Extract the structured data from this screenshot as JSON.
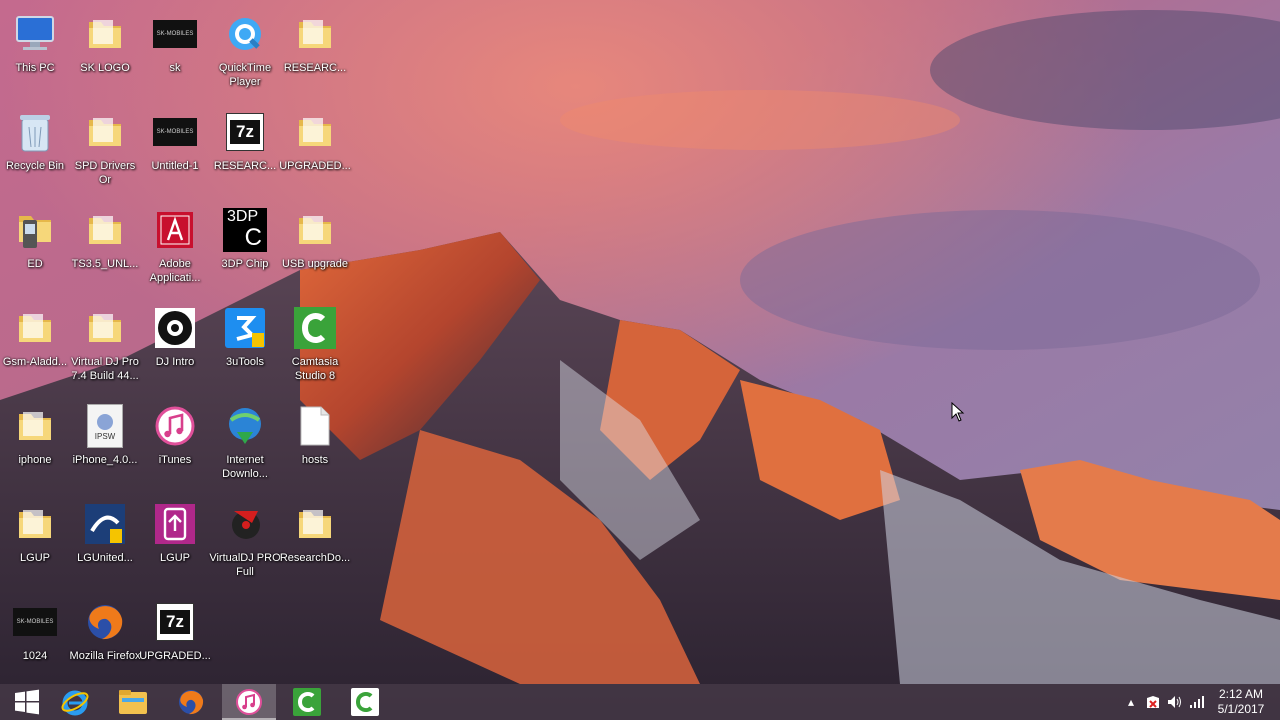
{
  "desktop": {
    "icons": [
      {
        "label": "This PC",
        "icon": "computer-icon"
      },
      {
        "label": "SK LOGO",
        "icon": "folder-icon"
      },
      {
        "label": "sk",
        "icon": "image-icon"
      },
      {
        "label": "QuickTime Player",
        "icon": "quicktime-icon"
      },
      {
        "label": "RESEARC...",
        "icon": "folder-icon"
      },
      {
        "label": "Recycle Bin",
        "icon": "recycle-bin-icon"
      },
      {
        "label": "SPD Drivers Or",
        "icon": "folder-icon"
      },
      {
        "label": "Untitled-1",
        "icon": "image-icon"
      },
      {
        "label": "RESEARC...",
        "icon": "7zip-icon"
      },
      {
        "label": "UPGRADED...",
        "icon": "folder-icon"
      },
      {
        "label": "ED",
        "icon": "phone-folder-icon"
      },
      {
        "label": "TS3.5_UNL...",
        "icon": "folder-icon"
      },
      {
        "label": "Adobe Applicati...",
        "icon": "adobe-icon"
      },
      {
        "label": "3DP Chip",
        "icon": "3dp-chip-icon"
      },
      {
        "label": "USB upgrade",
        "icon": "folder-icon"
      },
      {
        "label": "Gsm-Aladd...",
        "icon": "folder-icon"
      },
      {
        "label": "Virtual DJ Pro 7.4 Build 44...",
        "icon": "folder-icon"
      },
      {
        "label": "DJ Intro",
        "icon": "dj-intro-icon"
      },
      {
        "label": "3uTools",
        "icon": "3utools-icon"
      },
      {
        "label": "Camtasia Studio 8",
        "icon": "camtasia-icon"
      },
      {
        "label": "iphone",
        "icon": "folder-icon"
      },
      {
        "label": "iPhone_4.0...",
        "icon": "ipsw-icon"
      },
      {
        "label": "iTunes",
        "icon": "itunes-icon"
      },
      {
        "label": "Internet Downlo...",
        "icon": "idm-icon"
      },
      {
        "label": "hosts",
        "icon": "file-icon"
      },
      {
        "label": "LGUP",
        "icon": "folder-icon"
      },
      {
        "label": "LGUnited...",
        "icon": "lgunited-icon"
      },
      {
        "label": "LGUP",
        "icon": "lgup-icon"
      },
      {
        "label": "VirtualDJ PRO Full",
        "icon": "virtualdj-icon"
      },
      {
        "label": "ResearchDo...",
        "icon": "folder-icon"
      },
      {
        "label": "1024",
        "icon": "image-icon"
      },
      {
        "label": "Mozilla Firefox",
        "icon": "firefox-icon"
      },
      {
        "label": "UPGRADED...",
        "icon": "7zip-icon"
      }
    ],
    "image_icon_text": "SK-MOBILES",
    "zip_icon_text": "7z",
    "chip_icon_text": "3DP",
    "chip_icon_letter": "C",
    "ipsw_icon_text": "IPSW"
  },
  "taskbar": {
    "buttons": [
      {
        "name": "start-button",
        "icon": "windows-logo-icon"
      },
      {
        "name": "internet-explorer-button",
        "icon": "internet-explorer-icon"
      },
      {
        "name": "file-explorer-button",
        "icon": "file-explorer-icon"
      },
      {
        "name": "firefox-button",
        "icon": "firefox-icon"
      },
      {
        "name": "itunes-button",
        "icon": "itunes-icon",
        "active": true
      },
      {
        "name": "camtasia-button",
        "icon": "camtasia-icon"
      },
      {
        "name": "camtasia-recorder-button",
        "icon": "camtasia-icon"
      }
    ],
    "tray": {
      "time": "2:12 AM",
      "date": "5/1/2017",
      "show_hidden_glyph": "▴"
    }
  },
  "colors": {
    "taskbar": "#4a3a4c",
    "folder": "#f2d06b",
    "camtasia": "#3aa33a",
    "adobe": "#c8102e"
  }
}
